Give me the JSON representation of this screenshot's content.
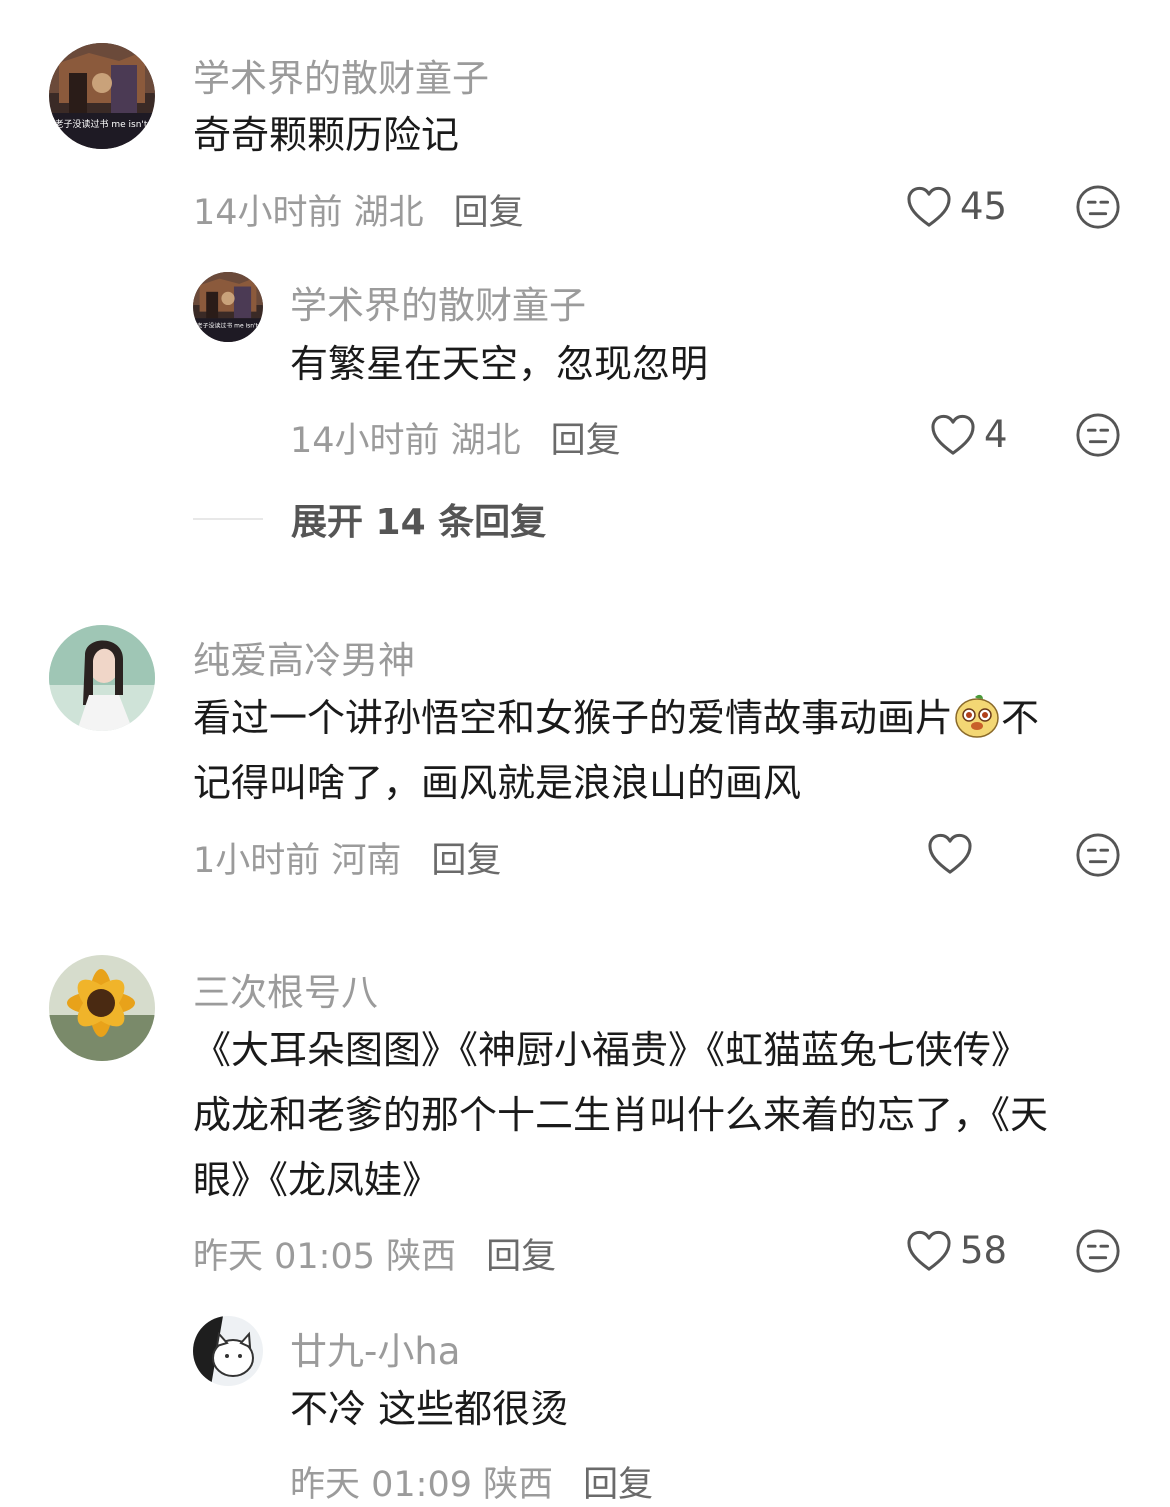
{
  "comments": [
    {
      "username": "学术界的散财童子",
      "avatar_caption": "欺负老子没读过书 me isn't 985",
      "text_lines": [
        "奇奇颗颗历险记"
      ],
      "time_location": "14小时前 湖北",
      "reply_label": "回复",
      "likes": "45",
      "replies": [
        {
          "username": "学术界的散财童子",
          "avatar_caption": "欺负老子没读过书 me isn't 985",
          "text_lines": [
            "有繁星在天空，忽现忽明"
          ],
          "time_location": "14小时前 湖北",
          "reply_label": "回复",
          "likes": "4"
        }
      ],
      "expand_label": "展开 14 条回复"
    },
    {
      "username": "纯爱高冷男神",
      "text_lines": [
        "看过一个讲孙悟空和女猴子的爱情故事动画片",
        "不",
        "记得叫啥了，画风就是浪浪山的画风"
      ],
      "time_location": "1小时前 河南",
      "reply_label": "回复",
      "likes": ""
    },
    {
      "username": "三次根号八",
      "text_lines": [
        "《大耳朵图图》《神厨小福贵》《虹猫蓝兔七侠传》",
        "成龙和老爹的那个十二生肖叫什么来着的忘了，《天",
        "眼》《龙凤娃》"
      ],
      "time_location": "昨天 01:05 陕西",
      "reply_label": "回复",
      "likes": "58",
      "replies": [
        {
          "username": "廿九-小ha",
          "text_lines": [
            "不冷 这些都很烫"
          ],
          "time_location": "昨天 01:09 陕西",
          "reply_label": "回复"
        }
      ]
    }
  ],
  "icons": {
    "like": "heart-outline-icon",
    "dislike": "neutral-face-icon",
    "emoji": "mascot-emoji-icon"
  },
  "colors": {
    "username": "#9b9b9b",
    "text": "#1a1a1a",
    "meta": "#9b9b9b",
    "icon": "#555555"
  }
}
